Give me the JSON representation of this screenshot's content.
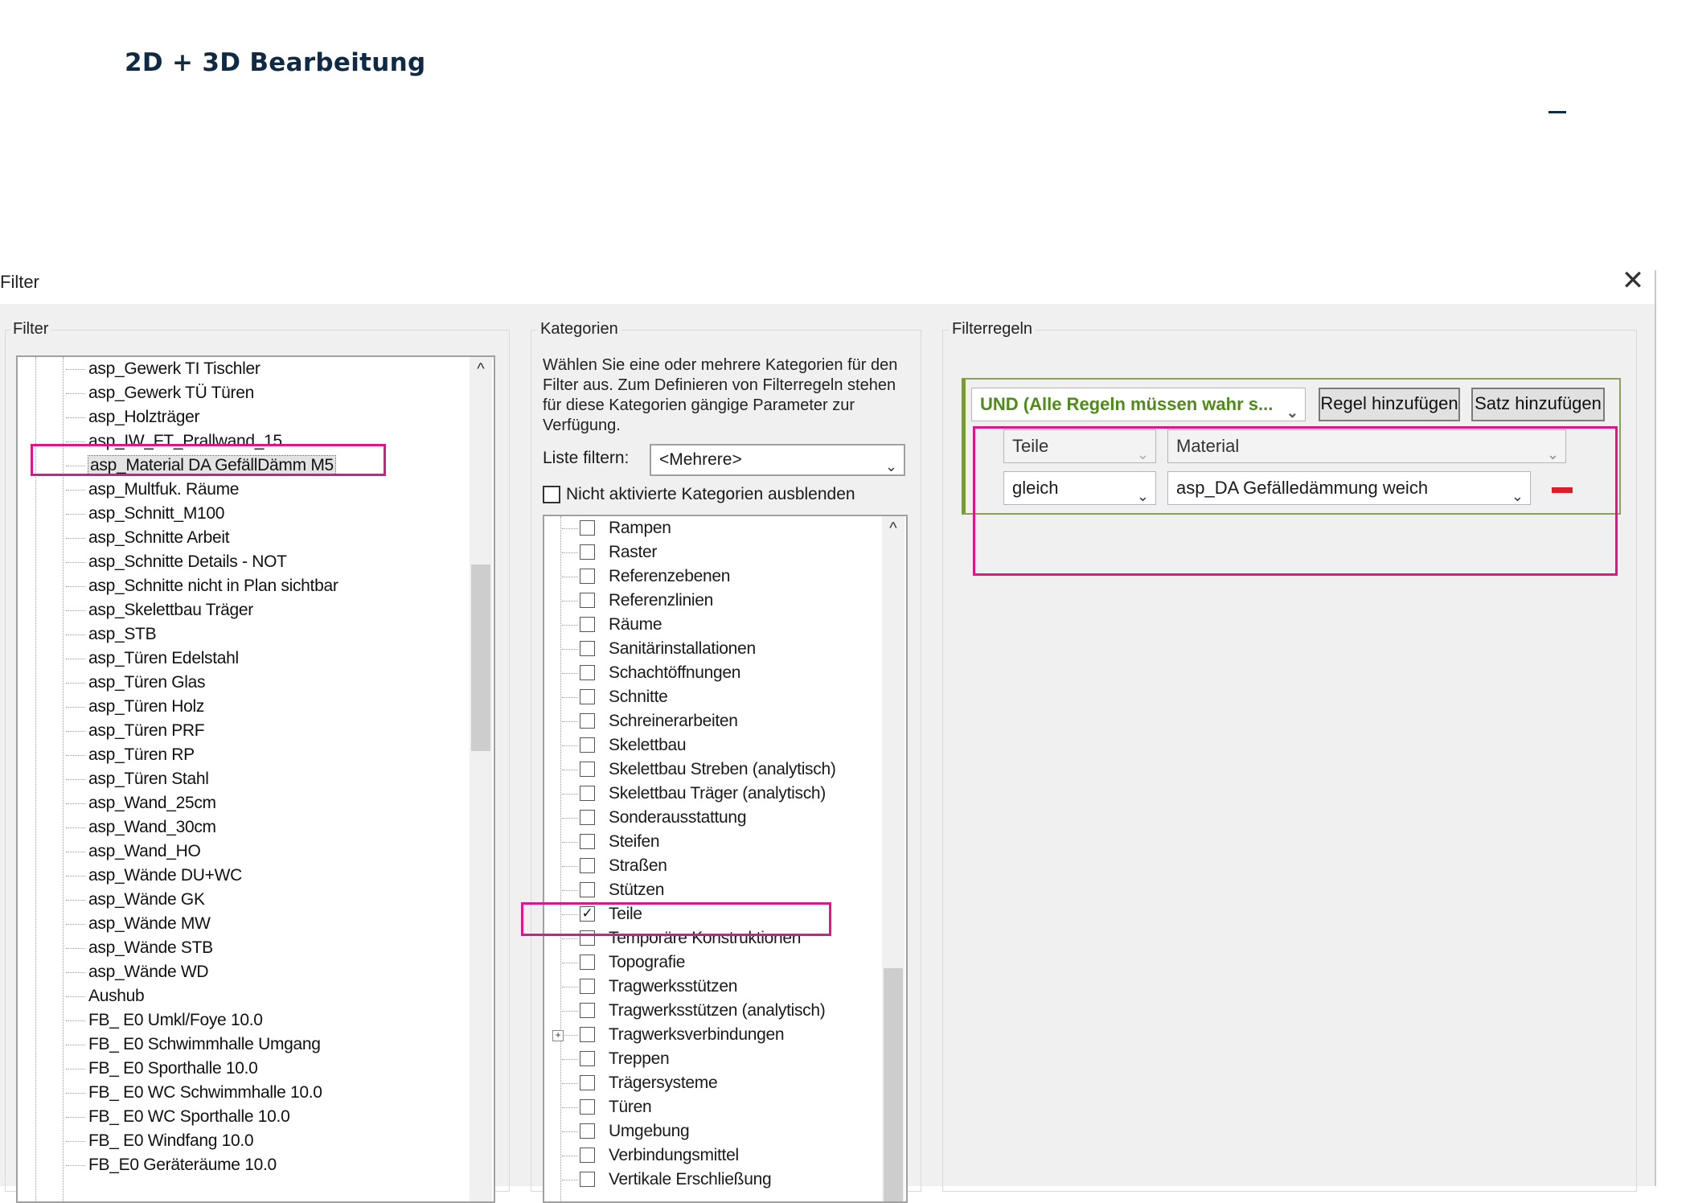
{
  "page": {
    "heading": "2D + 3D Bearbeitung"
  },
  "dialog": {
    "title": "Filter",
    "close_glyph": "✕"
  },
  "filter_panel": {
    "label": "Filter",
    "items": [
      "asp_Gewerk TI Tischler",
      "asp_Gewerk TÜ Türen",
      "asp_Holzträger",
      "asp_IW_FT_Prallwand_15",
      "asp_Material DA GefällDämm M5",
      "asp_Multfuk. Räume",
      "asp_Schnitt_M100",
      "asp_Schnitte Arbeit",
      "asp_Schnitte Details - NOT",
      "asp_Schnitte nicht in Plan sichtbar",
      "asp_Skelettbau Träger",
      "asp_STB",
      "asp_Türen Edelstahl",
      "asp_Türen Glas",
      "asp_Türen Holz",
      "asp_Türen PRF",
      "asp_Türen RP",
      "asp_Türen Stahl",
      "asp_Wand_25cm",
      "asp_Wand_30cm",
      "asp_Wand_HO",
      "asp_Wände DU+WC",
      "asp_Wände GK",
      "asp_Wände MW",
      "asp_Wände STB",
      "asp_Wände WD",
      "Aushub",
      "FB_ E0  Umkl/Foye 10.0",
      "FB_ E0 Schwimmhalle Umgang",
      "FB_ E0 Sporthalle 10.0",
      "FB_ E0 WC Schwimmhalle 10.0",
      "FB_ E0 WC Sporthalle 10.0",
      "FB_ E0 Windfang 10.0",
      "FB_E0 Geräteräume  10.0"
    ],
    "selected_index": 4,
    "scroll_up_glyph": "^"
  },
  "categories_panel": {
    "label": "Kategorien",
    "description_lines": [
      "Wählen Sie eine oder mehrere Kategorien für den",
      "Filter aus. Zum Definieren von Filterregeln stehen",
      "für diese Kategorien gängige Parameter zur",
      "Verfügung."
    ],
    "list_filter_label": "Liste filtern:",
    "list_filter_value": "<Mehrere>",
    "hide_unchecked_label": "Nicht aktivierte Kategorien ausblenden",
    "hide_unchecked_checked": false,
    "items": [
      {
        "label": "Rampen",
        "checked": false
      },
      {
        "label": "Raster",
        "checked": false
      },
      {
        "label": "Referenzebenen",
        "checked": false
      },
      {
        "label": "Referenzlinien",
        "checked": false
      },
      {
        "label": "Räume",
        "checked": false
      },
      {
        "label": "Sanitärinstallationen",
        "checked": false
      },
      {
        "label": "Schachtöffnungen",
        "checked": false
      },
      {
        "label": "Schnitte",
        "checked": false
      },
      {
        "label": "Schreinerarbeiten",
        "checked": false
      },
      {
        "label": "Skelettbau",
        "checked": false
      },
      {
        "label": "Skelettbau Streben (analytisch)",
        "checked": false
      },
      {
        "label": "Skelettbau Träger (analytisch)",
        "checked": false
      },
      {
        "label": "Sonderausstattung",
        "checked": false
      },
      {
        "label": "Steifen",
        "checked": false
      },
      {
        "label": "Straßen",
        "checked": false
      },
      {
        "label": "Stützen",
        "checked": false
      },
      {
        "label": "Teile",
        "checked": true
      },
      {
        "label": "Temporäre Konstruktionen",
        "checked": false
      },
      {
        "label": "Topografie",
        "checked": false
      },
      {
        "label": "Tragwerksstützen",
        "checked": false
      },
      {
        "label": "Tragwerksstützen (analytisch)",
        "checked": false
      },
      {
        "label": "Tragwerksverbindungen",
        "checked": false,
        "expandable": true
      },
      {
        "label": "Treppen",
        "checked": false
      },
      {
        "label": "Trägersysteme",
        "checked": false
      },
      {
        "label": "Türen",
        "checked": false
      },
      {
        "label": "Umgebung",
        "checked": false
      },
      {
        "label": "Verbindungsmittel",
        "checked": false
      },
      {
        "label": "Vertikale Erschließung",
        "checked": false
      }
    ],
    "check_glyph": "✓",
    "expand_glyph": "+"
  },
  "rules_panel": {
    "label": "Filterregeln",
    "logic_value": "UND (Alle Regeln müssen wahr s...",
    "add_rule_label": "Regel hinzufügen",
    "add_set_label": "Satz hinzufügen",
    "rule": {
      "category": "Teile",
      "parameter": "Material",
      "operator": "gleich",
      "value": "asp_DA Gefälledämmung weich"
    }
  },
  "colors": {
    "highlight": "#e0158a",
    "logic_green": "#4f8a1a",
    "remove_red": "#d6202a"
  }
}
